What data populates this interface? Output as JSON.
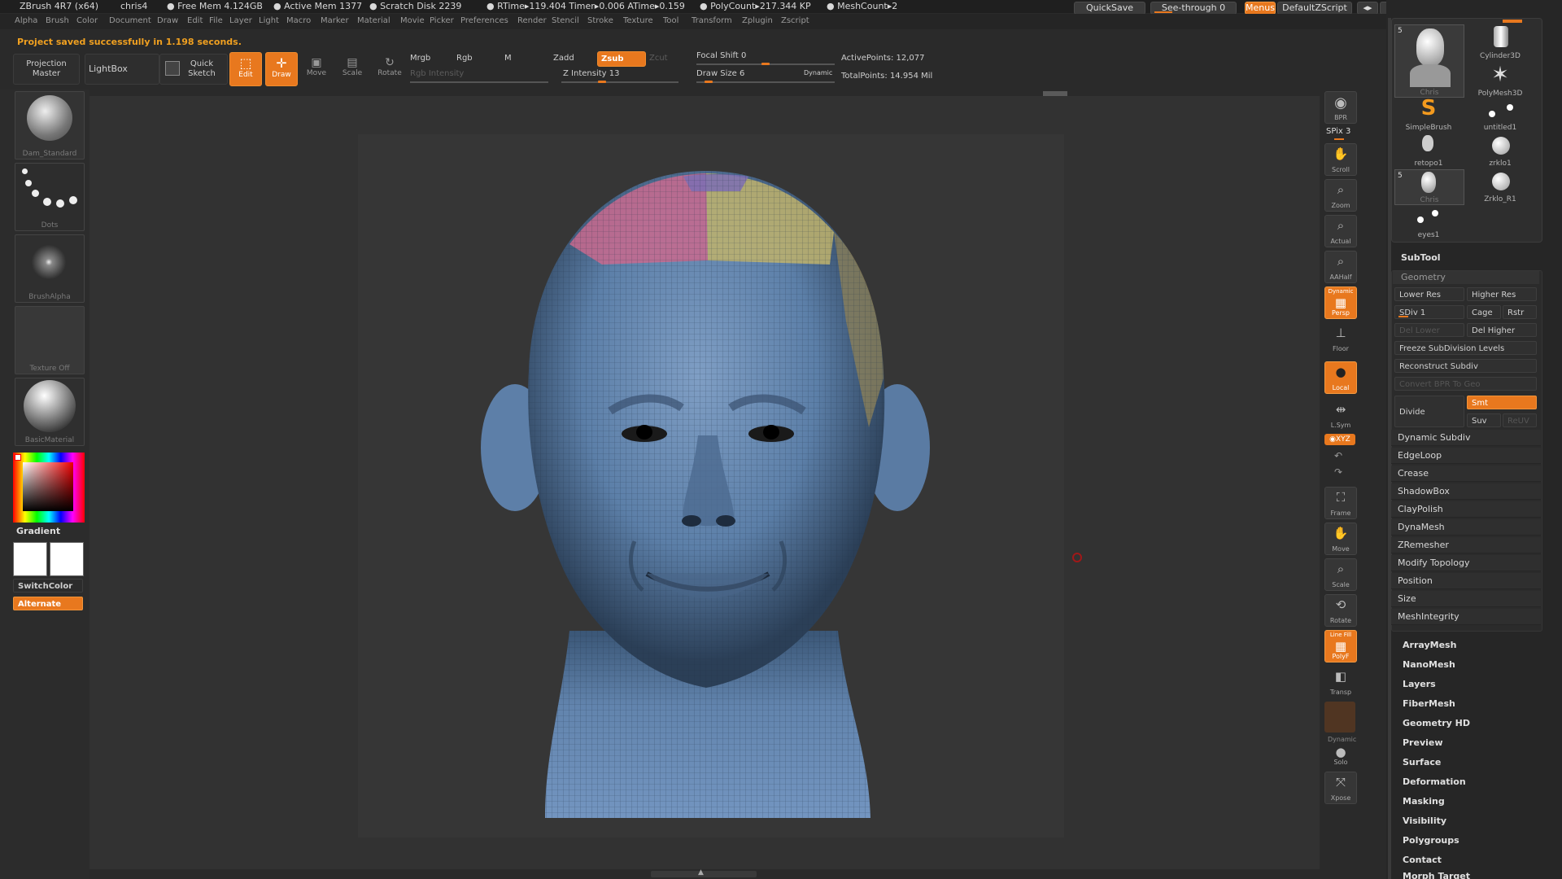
{
  "titlebar": {
    "app": "ZBrush 4R7 (x64)",
    "doc": "chris4",
    "free_mem": "● Free Mem 4.124GB",
    "active_mem": "● Active Mem 1377",
    "scratch": "● Scratch Disk 2239",
    "rtime": "● RTime▸119.404 Timer▸0.006 ATime▸0.159",
    "polycount": "● PolyCount▸217.344 KP",
    "meshcount": "● MeshCount▸2",
    "quicksave": "QuickSave",
    "see_through": "See-through  0",
    "menus": "Menus",
    "default_zscript": "DefaultZScript"
  },
  "menubar": [
    "Alpha",
    "Brush",
    "Color",
    "Document",
    "Draw",
    "Edit",
    "File",
    "Layer",
    "Light",
    "Macro",
    "Marker",
    "Material",
    "Movie",
    "Picker",
    "Preferences",
    "Render",
    "Stencil",
    "Stroke",
    "Texture",
    "Tool",
    "Transform",
    "Zplugin",
    "Zscript"
  ],
  "status": "Project saved successfully in 1.198 seconds.",
  "toolbar": {
    "projection_master": "Projection Master",
    "lightbox": "LightBox",
    "quick_sketch": "Quick Sketch",
    "edit": "Edit",
    "draw": "Draw",
    "move": "Move",
    "scale": "Scale",
    "rotate": "Rotate",
    "mrgb": "Mrgb",
    "rgb": "Rgb",
    "m": "M",
    "rgb_intensity": "Rgb Intensity",
    "zadd": "Zadd",
    "zsub": "Zsub",
    "zcut": "Zcut",
    "z_intensity": "Z Intensity 13",
    "focal_shift": "Focal Shift 0",
    "draw_size": "Draw Size 6",
    "dynamic": "Dynamic",
    "active_points": "ActivePoints: 12,077",
    "total_points": "TotalPoints: 14.954 Mil"
  },
  "left": {
    "brush": "Dam_Standard",
    "stroke": "Dots",
    "alpha": "BrushAlpha",
    "texture": "Texture Off",
    "material": "BasicMaterial",
    "gradient": "Gradient",
    "switch_color": "SwitchColor",
    "alternate": "Alternate"
  },
  "shelf": {
    "bpr": "BPR",
    "spix": "SPix 3",
    "scroll": "Scroll",
    "zoom": "Zoom",
    "actual": "Actual",
    "aahalf": "AAHalf",
    "dynamic": "Dynamic",
    "persp": "Persp",
    "floor": "Floor",
    "local": "Local",
    "lsym": "L.Sym",
    "xyz": "◉XYZ",
    "frame": "Frame",
    "move": "Move",
    "scale": "Scale",
    "rotate": "Rotate",
    "linefill": "Line Fill",
    "polyf": "PolyF",
    "transp": "Transp",
    "dynamic2": "Dynamic",
    "solo": "Solo",
    "xpose": "Xpose"
  },
  "subtools": {
    "count5a": "5",
    "count5b": "5",
    "chris1": "Chris",
    "cylinder": "Cylinder3D",
    "polymesh": "PolyMesh3D",
    "simplebrush": "SimpleBrush",
    "untitled": "untitled1",
    "retopo": "retopo1",
    "zrklo1": "zrklo1",
    "chris2": "Chris",
    "zrklo_r1": "Zrklo_R1",
    "eyes": "eyes1"
  },
  "panel": {
    "subtool": "SubTool",
    "geometry": "Geometry",
    "lower_res": "Lower Res",
    "higher_res": "Higher Res",
    "sdiv": "SDiv 1",
    "cage": "Cage",
    "rstr": "Rstr",
    "del_lower": "Del Lower",
    "del_higher": "Del Higher",
    "freeze": "Freeze SubDivision Levels",
    "reconstruct": "Reconstruct Subdiv",
    "convert_bpr": "Convert BPR To Geo",
    "divide": "Divide",
    "smt": "Smt",
    "suv": "Suv",
    "reuv": "ReUV",
    "geo_items": [
      "Dynamic Subdiv",
      "EdgeLoop",
      "Crease",
      "ShadowBox",
      "ClayPolish",
      "DynaMesh",
      "ZRemesher",
      "Modify Topology",
      "Position",
      "Size",
      "MeshIntegrity"
    ],
    "tool_menus": [
      "ArrayMesh",
      "NanoMesh",
      "Layers",
      "FiberMesh",
      "Geometry HD",
      "Preview",
      "Surface",
      "Deformation",
      "Masking",
      "Visibility",
      "Polygroups",
      "Contact",
      "Morph Target"
    ]
  }
}
